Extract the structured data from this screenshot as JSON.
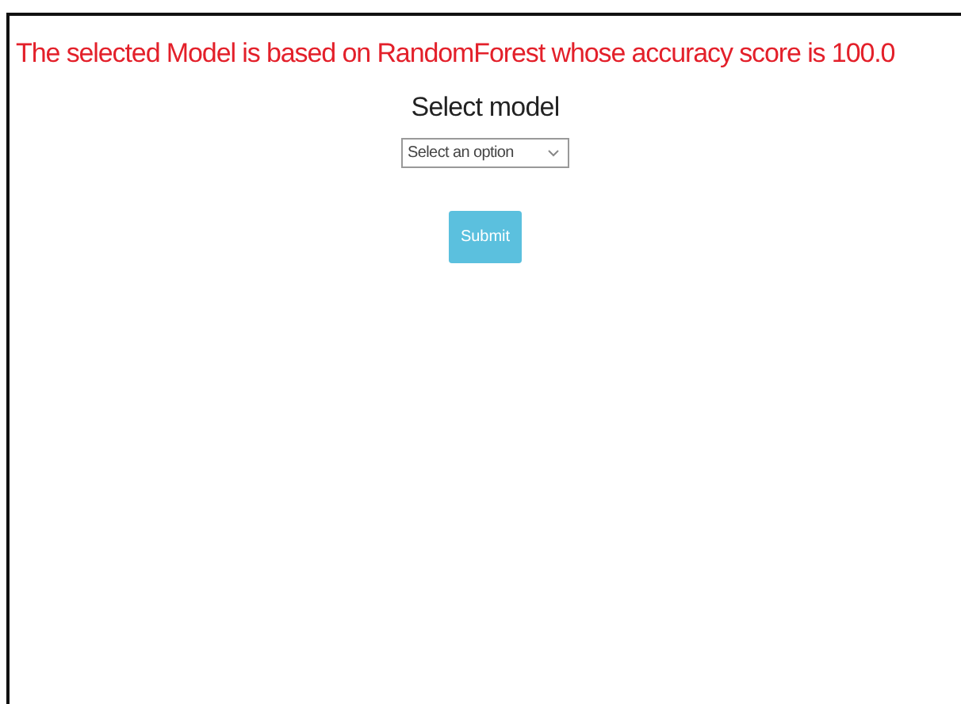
{
  "result_message": "The selected Model is based on RandomForest whose accuracy score is 100.0",
  "form": {
    "heading": "Select model",
    "select": {
      "placeholder": "Select an option"
    },
    "submit_button": "Submit"
  }
}
